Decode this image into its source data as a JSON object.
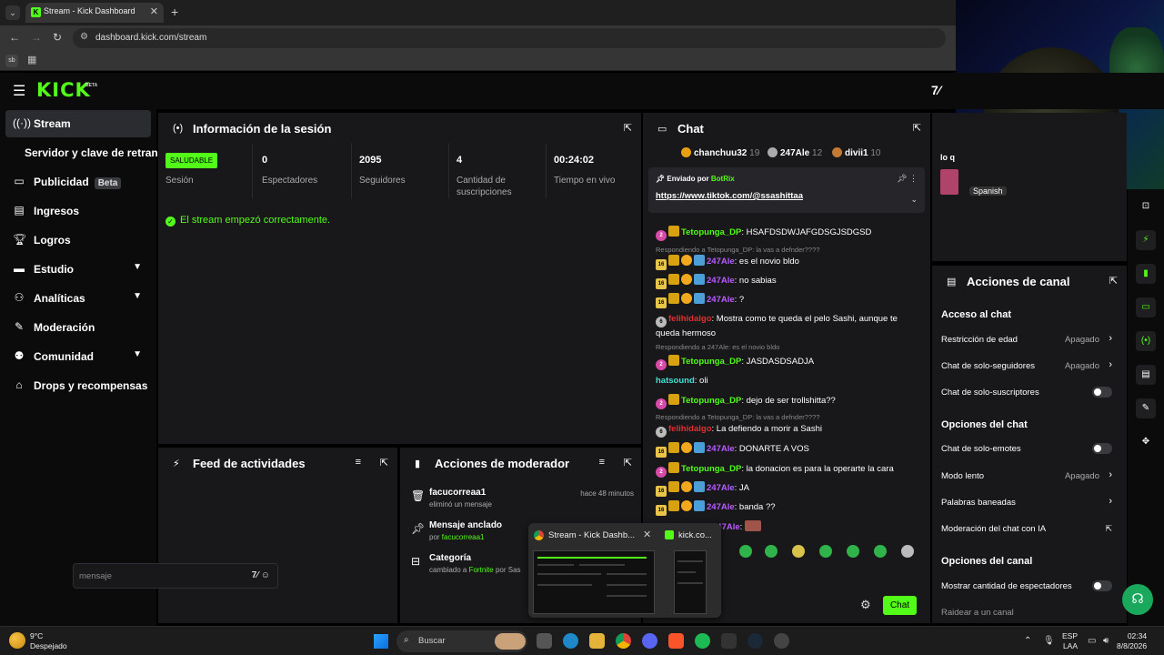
{
  "browser": {
    "tab_title": "Stream - Kick Dashboard",
    "url": "dashboard.kick.com/stream",
    "bookmark_label": "sb"
  },
  "header": {
    "logo": "KICK",
    "logo_badge": "BETA"
  },
  "sidebar": {
    "items": [
      {
        "label": "Stream",
        "icon": "broadcast-icon"
      },
      {
        "label": "Servidor y clave de retransmisión",
        "icon": ""
      },
      {
        "label": "Publicidad",
        "badge": "Beta",
        "icon": "megaphone-icon"
      },
      {
        "label": "Ingresos",
        "icon": "chart-icon"
      },
      {
        "label": "Logros",
        "icon": "trophy-icon"
      },
      {
        "label": "Estudio",
        "icon": "studio-icon"
      },
      {
        "label": "Analíticas",
        "icon": "analytics-icon"
      },
      {
        "label": "Moderación",
        "icon": "wrench-icon"
      },
      {
        "label": "Comunidad",
        "icon": "people-icon"
      },
      {
        "label": "Drops y recompensas",
        "icon": "gift-icon"
      }
    ]
  },
  "session": {
    "title": "Información de la sesión",
    "status": "SALUDABLE",
    "status_label": "Sesión",
    "stats": [
      {
        "value": "0",
        "label": "Espectadores"
      },
      {
        "value": "2095",
        "label": "Seguidores"
      },
      {
        "value": "4",
        "label": "Cantidad de suscripciones"
      },
      {
        "value": "00:24:02",
        "label": "Tiempo en vivo"
      }
    ],
    "message": "El stream empezó correctamente."
  },
  "feed": {
    "title": "Feed de actividades"
  },
  "mod_actions": {
    "title": "Acciones de moderador",
    "items": [
      {
        "title": "facucorreaa1",
        "sub": "eliminó un mensaje",
        "time": "hace 48 minutos"
      },
      {
        "title": "Mensaje anclado",
        "sub_prefix": "por ",
        "sub_highlight": "facucorreaa1"
      },
      {
        "title": "Categoría",
        "sub_prefix": "cambiado a ",
        "sub_highlight": "Fortnite",
        "sub_suffix": " por Sas"
      }
    ]
  },
  "chat": {
    "title": "Chat",
    "top_gifters": [
      {
        "name": "chanchuu32",
        "count": "19"
      },
      {
        "name": "247Ale",
        "count": "12"
      },
      {
        "name": "divii1",
        "count": "10"
      }
    ],
    "pinned": {
      "label_prefix": "Enviado por",
      "author": "BotRix",
      "link": "https://www.tiktok.com/@ssashittaa"
    },
    "messages": [
      {
        "user": "Tetopunga_DP",
        "text": "HSAFDSDWJAFGDSGJSDGSD",
        "color": "#53fc18"
      },
      {
        "reply": "Respondiendo a Tetopunga_DP: la vas a defnder????"
      },
      {
        "user": "247Ale",
        "text": "es el novio bldo",
        "color": "#b85cff"
      },
      {
        "user": "247Ale",
        "text": "no sabias",
        "color": "#b85cff"
      },
      {
        "user": "247Ale",
        "text": "?",
        "color": "#b85cff"
      },
      {
        "user": "felihidalgo",
        "text": "Mostra como te queda el pelo Sashi, aunque te queda hermoso",
        "color": "#e0302f"
      },
      {
        "reply": "Respondiendo a 247Ale: es el novio bldo"
      },
      {
        "user": "Tetopunga_DP",
        "text": "JASDASDSADJA",
        "color": "#53fc18"
      },
      {
        "user": "hatsound",
        "text": "oli",
        "color": "#44e0d4"
      },
      {
        "user": "Tetopunga_DP",
        "text": "dejo de ser trollshitta??",
        "color": "#53fc18"
      },
      {
        "reply": "Respondiendo a Tetopunga_DP: la vas a defnder????"
      },
      {
        "user": "felihidalgo",
        "text": "La defiendo a morir a Sashi",
        "color": "#e0302f"
      },
      {
        "user": "247Ale",
        "text": "DONARTE A VOS",
        "color": "#b85cff"
      },
      {
        "user": "Tetopunga_DP",
        "text": "la donacion es para la operarte la cara",
        "color": "#53fc18"
      },
      {
        "user": "247Ale",
        "text": "JA",
        "color": "#b85cff"
      },
      {
        "user": "247Ale",
        "text": "banda ??",
        "color": "#b85cff"
      },
      {
        "user": "247Ale",
        "text": "",
        "color": "#b85cff"
      }
    ],
    "input_placeholder": "mensaje",
    "send_label": "Chat"
  },
  "channel_actions": {
    "title": "Acciones de canal",
    "sections": [
      {
        "heading": "Acceso al chat",
        "rows": [
          {
            "label": "Restricción de edad",
            "value": "Apagado",
            "kind": "chevron"
          },
          {
            "label": "Chat de solo-seguidores",
            "value": "Apagado",
            "kind": "chevron"
          },
          {
            "label": "Chat de solo-suscriptores",
            "kind": "toggle"
          }
        ]
      },
      {
        "heading": "Opciones del chat",
        "rows": [
          {
            "label": "Chat de solo-emotes",
            "kind": "toggle"
          },
          {
            "label": "Modo lento",
            "value": "Apagado",
            "kind": "chevron"
          },
          {
            "label": "Palabras baneadas",
            "kind": "chevron"
          },
          {
            "label": "Moderación del chat con IA",
            "kind": "external"
          }
        ]
      },
      {
        "heading": "Opciones del canal",
        "rows": [
          {
            "label": "Mostrar cantidad de espectadores",
            "kind": "toggle"
          },
          {
            "label": "Raidear a un canal",
            "kind": "none"
          }
        ]
      }
    ]
  },
  "peek": {
    "partial_text": "lo q",
    "language_tag": "Spanish"
  },
  "tab_preview": {
    "title": "Stream - Kick Dashb...",
    "title2": "kick.co..."
  },
  "taskbar": {
    "temperature": "9°C",
    "condition": "Despejado",
    "search_label": "Buscar",
    "lang_1": "ESP",
    "lang_2": "LAA",
    "time": "02:34",
    "date": "8/8/2026"
  },
  "colors": {
    "accent": "#53fc18",
    "panel": "#18181b",
    "background": "#0b0b0c"
  }
}
